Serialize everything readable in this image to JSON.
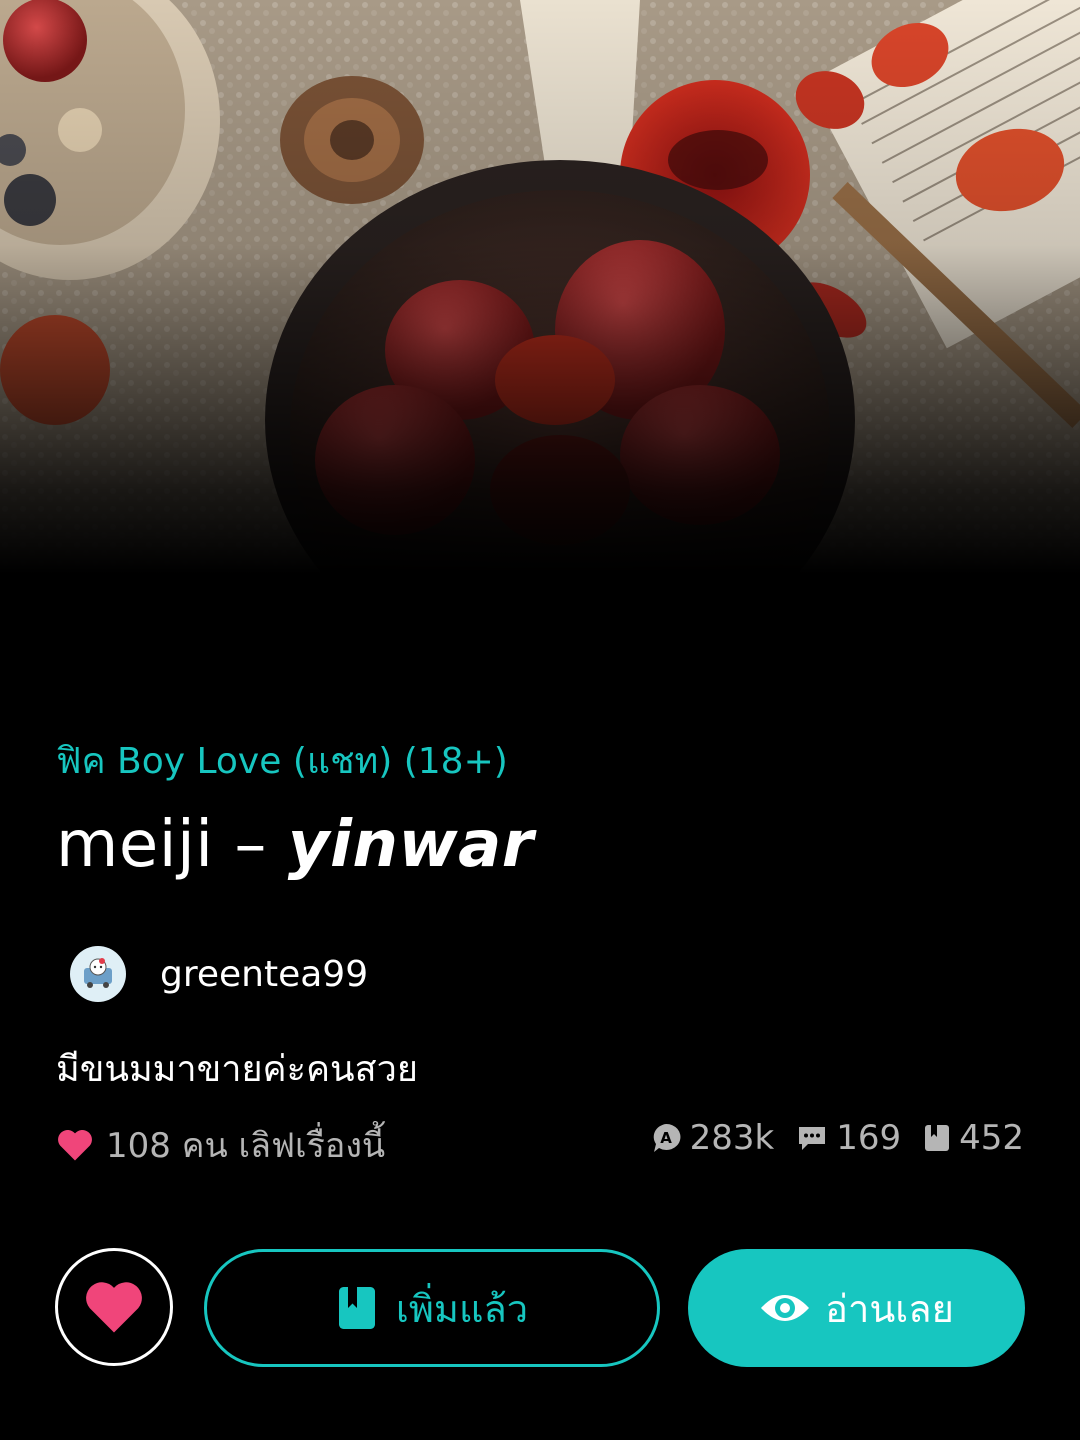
{
  "cover": {
    "description_icon": "cover-image"
  },
  "story": {
    "genre": "ฟิค Boy Love (แชท)  (18+)",
    "title_main": "meiji – ",
    "title_italic": "yinwar",
    "author": "greentea99",
    "description": "มีขนมมาขายค่ะคนสวย",
    "likes_text": "108 คน เลิฟเรื่องนี้"
  },
  "stats": {
    "views": "283k",
    "comments": "169",
    "chapters": "452"
  },
  "actions": {
    "added_label": "เพิ่มแล้ว",
    "read_label": "อ่านเลย"
  },
  "colors": {
    "accent": "#17c6c0",
    "heart": "#f0457a",
    "background": "#000000"
  }
}
